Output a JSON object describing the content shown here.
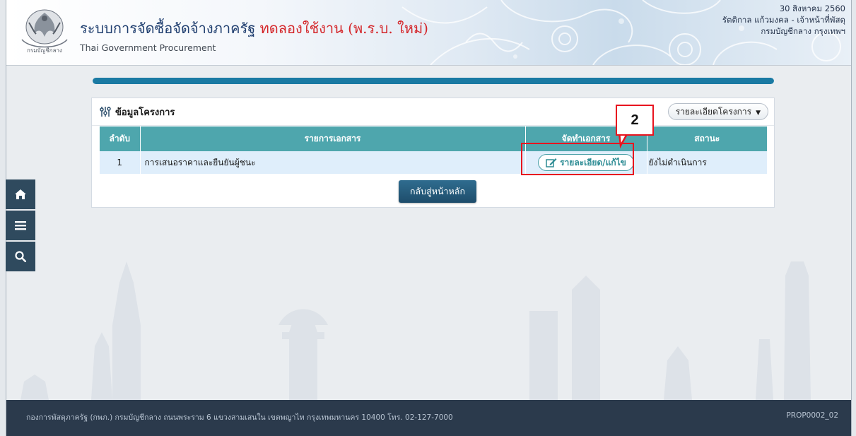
{
  "header": {
    "title_main": "ระบบการจัดซื้อจัดจ้างภาครัฐ",
    "title_trial": "ทดลองใช้งาน (พ.ร.บ. ใหม่)",
    "subtitle": "Thai Government Procurement",
    "date": "30 สิงหาคม 2560",
    "user": "รัตติกาล แก้วมงคล - เจ้าหน้าที่พัสดุ",
    "department": "กรมบัญชีกลาง กรุงเทพฯ"
  },
  "progress": {
    "percent": 100,
    "color": "#1a7aa3"
  },
  "panel": {
    "title": "ข้อมูลโครงการ",
    "detail_dropdown": "รายละเอียดโครงการ"
  },
  "table": {
    "headers": [
      "ลำดับ",
      "รายการเอกสาร",
      "จัดทำเอกสาร",
      "สถานะ"
    ],
    "rows": [
      {
        "no": "1",
        "document": "การเสนอราคาและยืนยันผู้ชนะ",
        "action": "รายละเอียด/แก้ไข",
        "status": "ยังไม่ดำเนินการ"
      }
    ]
  },
  "back_button": "กลับสู่หน้าหลัก",
  "annotation": {
    "step": "2",
    "color": "#e8141f"
  },
  "sidenav": [
    {
      "name": "home",
      "icon": "home-icon"
    },
    {
      "name": "menu",
      "icon": "hamburger-menu-icon"
    },
    {
      "name": "search",
      "icon": "search-icon"
    }
  ],
  "footer": {
    "address": "กองการพัสดุภาครัฐ (กพภ.) กรมบัญชีกลาง ถนนพระราม 6 แขวงสามเสนใน เขตพญาไท กรุงเทพมหานคร 10400 โทร. 02-127-7000",
    "page_code": "PROP0002_02"
  },
  "colors": {
    "table_header": "#4ea6ad",
    "row_bg": "#dfeefb",
    "footer_bg": "#2b3a4c",
    "sidenav_bg": "#2f4a5e",
    "title_trial": "#d4262a"
  }
}
